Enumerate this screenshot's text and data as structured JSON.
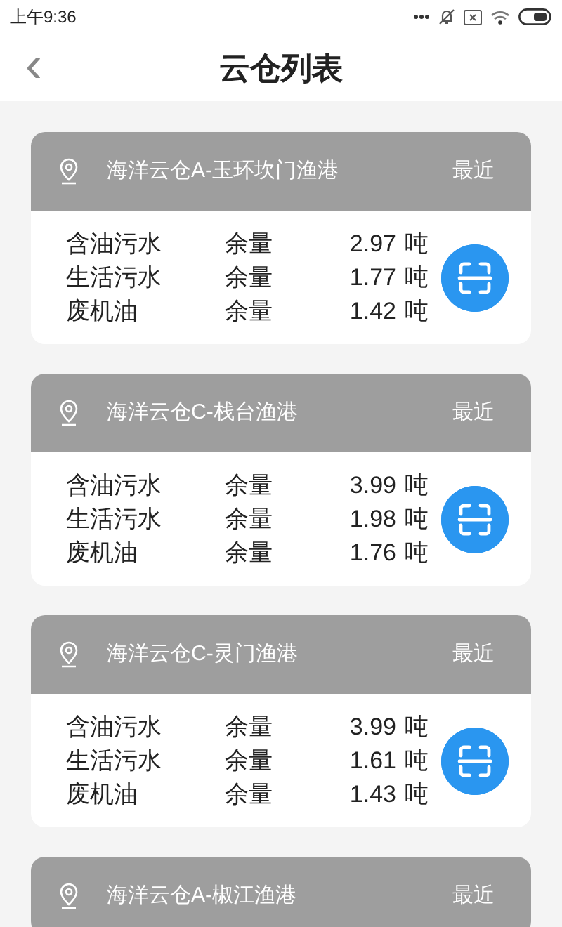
{
  "status_bar": {
    "time": "上午9:36"
  },
  "header": {
    "back": "‹",
    "title": "云仓列表"
  },
  "warehouses": [
    {
      "name": "海洋云仓A-玉环坎门渔港",
      "tag": "最近",
      "rows": [
        {
          "label": "含油污水",
          "metric": "余量",
          "value": "2.97",
          "unit": "吨"
        },
        {
          "label": "生活污水",
          "metric": "余量",
          "value": "1.77",
          "unit": "吨"
        },
        {
          "label": "废机油",
          "metric": "余量",
          "value": "1.42",
          "unit": "吨"
        }
      ]
    },
    {
      "name": "海洋云仓C-栈台渔港",
      "tag": "最近",
      "rows": [
        {
          "label": "含油污水",
          "metric": "余量",
          "value": "3.99",
          "unit": "吨"
        },
        {
          "label": "生活污水",
          "metric": "余量",
          "value": "1.98",
          "unit": "吨"
        },
        {
          "label": "废机油",
          "metric": "余量",
          "value": "1.76",
          "unit": "吨"
        }
      ]
    },
    {
      "name": "海洋云仓C-灵门渔港",
      "tag": "最近",
      "rows": [
        {
          "label": "含油污水",
          "metric": "余量",
          "value": "3.99",
          "unit": "吨"
        },
        {
          "label": "生活污水",
          "metric": "余量",
          "value": "1.61",
          "unit": "吨"
        },
        {
          "label": "废机油",
          "metric": "余量",
          "value": "1.43",
          "unit": "吨"
        }
      ]
    },
    {
      "name": "海洋云仓A-椒江渔港",
      "tag": "最近"
    }
  ]
}
